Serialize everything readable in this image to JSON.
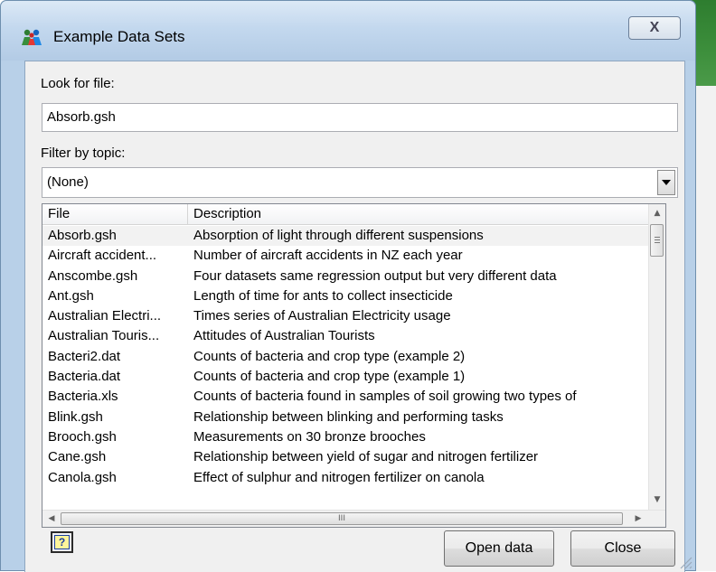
{
  "window": {
    "title": "Example Data Sets",
    "close_glyph": "X"
  },
  "search": {
    "label": "Look for file:",
    "value": "Absorb.gsh"
  },
  "filter": {
    "label": "Filter by topic:",
    "selected": "(None)"
  },
  "list": {
    "columns": [
      "File",
      "Description"
    ],
    "rows": [
      {
        "file": "Absorb.gsh",
        "description": "Absorption of light through different suspensions"
      },
      {
        "file": "Aircraft accident...",
        "description": "Number of aircraft accidents in NZ each year"
      },
      {
        "file": "Anscombe.gsh",
        "description": "Four datasets same regression output but very different data"
      },
      {
        "file": "Ant.gsh",
        "description": "Length of time for ants to collect insecticide"
      },
      {
        "file": "Australian Electri...",
        "description": "Times series of Australian Electricity usage"
      },
      {
        "file": "Australian Touris...",
        "description": "Attitudes of Australian Tourists"
      },
      {
        "file": "Bacteri2.dat",
        "description": "Counts of bacteria and crop type (example 2)"
      },
      {
        "file": "Bacteria.dat",
        "description": "Counts of bacteria and crop type (example 1)"
      },
      {
        "file": "Bacteria.xls",
        "description": "Counts of bacteria found in samples of soil growing two types of"
      },
      {
        "file": "Blink.gsh",
        "description": "Relationship between blinking and performing tasks"
      },
      {
        "file": "Brooch.gsh",
        "description": "Measurements on 30 bronze brooches"
      },
      {
        "file": "Cane.gsh",
        "description": "Relationship between yield of sugar and nitrogen fertilizer"
      },
      {
        "file": "Canola.gsh",
        "description": "Effect of sulphur and nitrogen fertilizer on canola"
      }
    ],
    "hscroll_thumb_glyph": "III"
  },
  "buttons": {
    "help": "?",
    "open": "Open data",
    "close": "Close"
  },
  "icons": {
    "title": "people-group-icon",
    "help": "help-icon",
    "dropdown": "chevron-down-icon"
  }
}
